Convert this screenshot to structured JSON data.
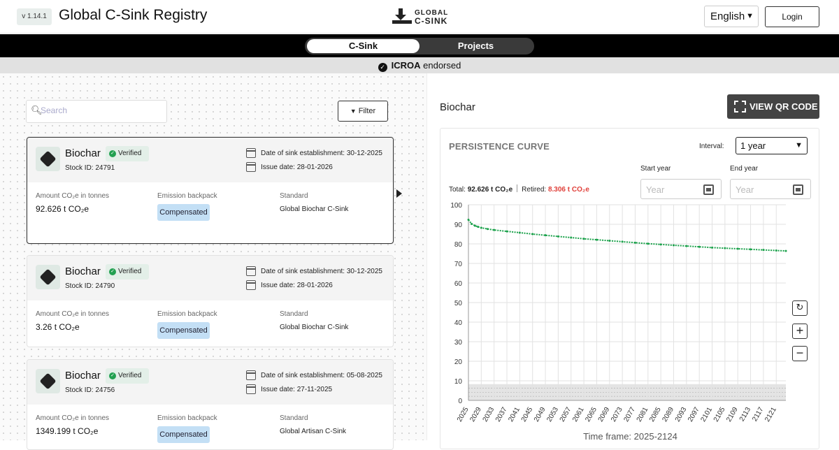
{
  "header": {
    "version": "v 1.14.1",
    "title": "Global C-Sink Registry",
    "logo_line1": "GLOBAL",
    "logo_line2": "C-SINK",
    "language": "English",
    "login_label": "Login"
  },
  "nav": {
    "tab_csink": "C-Sink",
    "tab_projects": "Projects",
    "active_tab": "C-Sink"
  },
  "endorsement": {
    "bold": "ICROA",
    "text": "endorsed"
  },
  "list": {
    "search_placeholder": "Search",
    "filter_label": "Filter",
    "cards": [
      {
        "name": "Biochar",
        "verified": "Verified",
        "stock_id": "Stock ID: 24791",
        "date_establishment": "Date of sink establishment: 30-12-2025",
        "issue_date": "Issue date: 28-01-2026",
        "amount_label": "Amount CO₂e in tonnes",
        "amount": "92.626 t CO₂e",
        "backpack_label": "Emission backpack",
        "backpack": "Compensated",
        "standard_label": "Standard",
        "standard": "Global Biochar C-Sink"
      },
      {
        "name": "Biochar",
        "verified": "Verified",
        "stock_id": "Stock ID: 24790",
        "date_establishment": "Date of sink establishment: 30-12-2025",
        "issue_date": "Issue date: 28-01-2026",
        "amount_label": "Amount CO₂e in tonnes",
        "amount": "3.26 t CO₂e",
        "backpack_label": "Emission backpack",
        "backpack": "Compensated",
        "standard_label": "Standard",
        "standard": "Global Biochar C-Sink"
      },
      {
        "name": "Biochar",
        "verified": "Verified",
        "stock_id": "Stock ID: 24756",
        "date_establishment": "Date of sink establishment: 05-08-2025",
        "issue_date": "Issue date: 27-11-2025",
        "amount_label": "Amount CO₂e in tonnes",
        "amount": "1349.199 t CO₂e",
        "backpack_label": "Emission backpack",
        "backpack": "Compensated",
        "standard_label": "Standard",
        "standard": "Global Artisan C-Sink"
      }
    ]
  },
  "detail": {
    "title": "Biochar",
    "qr_button": "VIEW QR CODE",
    "chart_title": "PERSISTENCE CURVE",
    "interval_label": "Interval:",
    "interval_value": "1 year",
    "start_year_label": "Start year",
    "end_year_label": "End year",
    "year_placeholder": "Year",
    "total_label": "Total:",
    "total_value": "92.626 t CO₂e",
    "retired_label": "Retired:",
    "retired_value": "8.306 t CO₂e",
    "timeframe": "Time frame: 2025-2124"
  },
  "colors": {
    "curve": "#1aa14a",
    "retired": "#e0403a",
    "badge": "#c3dff5",
    "verified_bg": "#e3efe8"
  },
  "chart_data": {
    "type": "line",
    "title": "PERSISTENCE CURVE",
    "xlabel": "Time frame: 2025-2124",
    "ylabel": "",
    "ylim": [
      0,
      100
    ],
    "yticks": [
      0,
      10,
      20,
      30,
      40,
      50,
      60,
      70,
      80,
      90,
      100
    ],
    "xlim": [
      2025,
      2124
    ],
    "xticks": [
      2025,
      2029,
      2033,
      2037,
      2041,
      2045,
      2049,
      2053,
      2057,
      2061,
      2065,
      2069,
      2073,
      2077,
      2081,
      2085,
      2089,
      2093,
      2097,
      2101,
      2105,
      2109,
      2113,
      2117,
      2121
    ],
    "grid": true,
    "series": [
      {
        "x": [
          2025,
          2026,
          2027,
          2028,
          2029,
          2031,
          2033,
          2037,
          2041,
          2045,
          2049,
          2053,
          2057,
          2061,
          2065,
          2069,
          2073,
          2077,
          2081,
          2085,
          2089,
          2093,
          2097,
          2101,
          2105,
          2109,
          2113,
          2117,
          2121,
          2124
        ],
        "y": [
          92.3,
          90.2,
          89.3,
          88.7,
          88.2,
          87.6,
          87.1,
          86.4,
          85.7,
          85.0,
          84.4,
          83.8,
          83.2,
          82.6,
          82.1,
          81.6,
          81.1,
          80.6,
          80.1,
          79.7,
          79.3,
          78.9,
          78.5,
          78.1,
          77.8,
          77.5,
          77.2,
          76.9,
          76.6,
          76.4
        ]
      }
    ],
    "retired_band": 8.306
  }
}
